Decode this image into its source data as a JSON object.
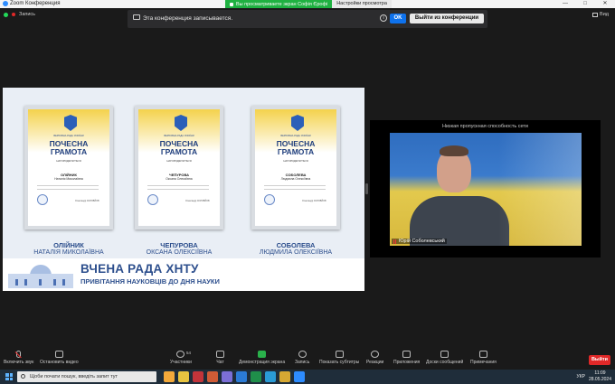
{
  "window": {
    "title": "Zoom Конференция"
  },
  "share_banner": {
    "viewing": "Вы просматриваете экран Софія Єрофі",
    "options": "Настройки просмотра"
  },
  "window_controls": {
    "minimize": "—",
    "maximize": "□",
    "close": "✕"
  },
  "status": {
    "recording_label": "Запись"
  },
  "notice": {
    "text": "Эта конференция записывается.",
    "ok": "OK",
    "leave": "Выйти из конференции",
    "info_icon": "i"
  },
  "view_button": {
    "label": "Вид"
  },
  "shared_screen": {
    "certificates": [
      {
        "org": "ВЕРХОВНА РАДА УКРАЇНИ",
        "heading_line1": "ПОЧЕСНА",
        "heading_line2": "ГРАМОТА",
        "awarded": "НАГОРОДЖУЄТЬСЯ",
        "surname": "ОЛІЙНИК",
        "given": "Наталія Миколаївна",
        "signature": "Олександр СОЛОВЙОВ"
      },
      {
        "org": "ВЕРХОВНА РАДА УКРАЇНИ",
        "heading_line1": "ПОЧЕСНА",
        "heading_line2": "ГРАМОТА",
        "awarded": "НАГОРОДЖУЄТЬСЯ",
        "surname": "ЧЕПУРОВА",
        "given": "Оксана Олексіївна",
        "signature": "Олександр СОЛОВЙОВ"
      },
      {
        "org": "ВЕРХОВНА РАДА УКРАЇНИ",
        "heading_line1": "ПОЧЕСНА",
        "heading_line2": "ГРАМОТА",
        "awarded": "НАГОРОДЖУЄТЬСЯ",
        "surname": "СОБОЛЕВА",
        "given": "Людмила Олексіївна",
        "signature": "Олександр СОЛОВЙОВ"
      }
    ],
    "captions": [
      {
        "surname": "ОЛІЙНИК",
        "name": "НАТАЛІЯ МИКОЛАЇВНА"
      },
      {
        "surname": "ЧЕПУРОВА",
        "name": "ОКСАНА ОЛЕКСІЇВНА"
      },
      {
        "surname": "СОБОЛЕВА",
        "name": "ЛЮДМИЛА ОЛЕКСІЇВНА"
      }
    ],
    "footer_title": "ВЧЕНА РАДА ХНТУ",
    "footer_subtitle": "ПРИВІТАННЯ НАУКОВЦІВ ДО ДНЯ НАУКИ"
  },
  "video_panel": {
    "caption": "Низкая пропускная способность сети",
    "participant_name": "Юрій Соболевський"
  },
  "toolbar": {
    "unmute": "Включить звук",
    "stop_video": "Остановить видео",
    "participants": "Участники",
    "participants_count": "54",
    "chat": "Чат",
    "share_screen": "Демонстрация экрана",
    "record": "Запись",
    "subtitles": "Показать субтитры",
    "reactions": "Реакции",
    "apps": "Приложения",
    "whiteboard": "Доски сообщений",
    "notes": "Примечания",
    "exit": "Выйти"
  },
  "taskbar": {
    "search_placeholder": "Щоби почати пошук, введіть запит тут",
    "language": "УКР",
    "time": "11:09",
    "date": "28.05.2024"
  },
  "colors": {
    "accent": "#0e72ed",
    "share_green": "#1fb141",
    "leave_red": "#e02828",
    "cert_blue": "#2d4f8d"
  }
}
